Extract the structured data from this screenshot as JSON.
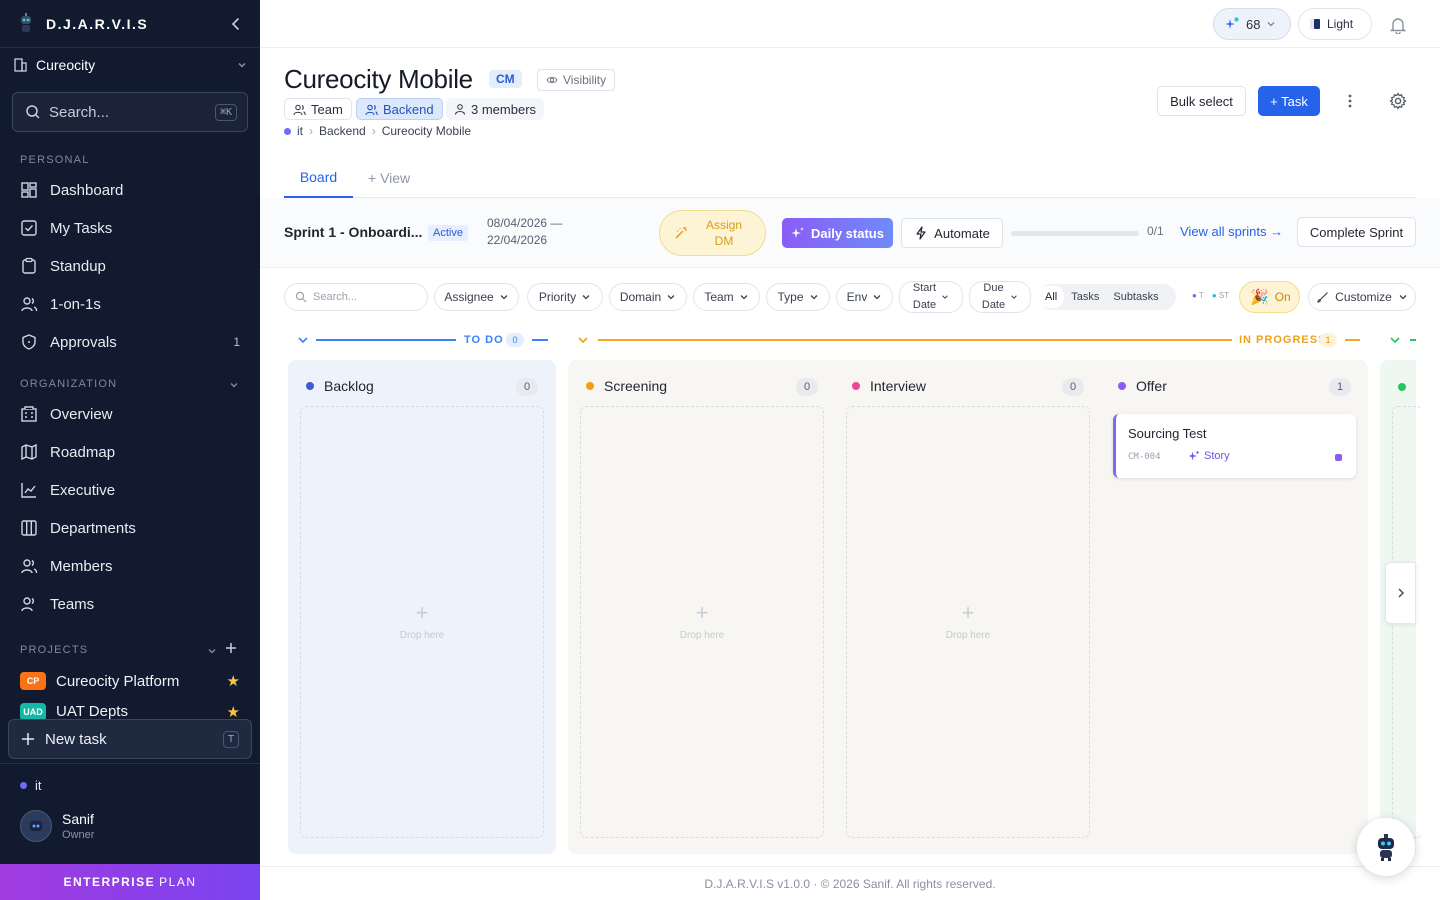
{
  "sidebar": {
    "brand": "D.J.A.R.V.I.S",
    "org": "Cureocity",
    "search_placeholder": "Search...",
    "search_kbd": "⌘K",
    "personal_label": "PERSONAL",
    "personal": [
      {
        "label": "Dashboard",
        "icon": "dashboard-icon"
      },
      {
        "label": "My Tasks",
        "icon": "checkbox-icon"
      },
      {
        "label": "Standup",
        "icon": "clipboard-icon"
      },
      {
        "label": "1-on-1s",
        "icon": "users-icon"
      },
      {
        "label": "Approvals",
        "icon": "shield-icon",
        "badge": "1"
      }
    ],
    "org_label": "ORGANIZATION",
    "organization": [
      {
        "label": "Overview",
        "icon": "building-icon"
      },
      {
        "label": "Roadmap",
        "icon": "map-icon"
      },
      {
        "label": "Executive",
        "icon": "chart-line-icon"
      },
      {
        "label": "Departments",
        "icon": "columns-icon"
      },
      {
        "label": "Members",
        "icon": "users-icon"
      },
      {
        "label": "Teams",
        "icon": "team-icon"
      }
    ],
    "projects_label": "PROJECTS",
    "projects": [
      {
        "tag": "CP",
        "name": "Cureocity Platform",
        "color": "#f97316"
      },
      {
        "tag": "UAD",
        "name": "UAT Depts",
        "color": "#14b8a6"
      }
    ],
    "new_task": "New task",
    "new_task_kbd": "T",
    "workspace": "it",
    "user": {
      "name": "Sanif",
      "role": "Owner"
    },
    "plan_bold": "ENTERPRISE",
    "plan_rest": "PLAN"
  },
  "topbar": {
    "points": "68",
    "theme": "Light"
  },
  "project": {
    "title": "Cureocity Mobile",
    "code": "CM",
    "visibility": "Visibility",
    "chips": {
      "team": "Team",
      "backend": "Backend",
      "members": "3 members"
    },
    "breadcrumb": [
      "it",
      "Backend",
      "Cureocity Mobile"
    ],
    "bulk_select": "Bulk select",
    "add_task": "+ Task"
  },
  "tabs": {
    "board": "Board",
    "view": "+ View"
  },
  "sprint": {
    "name": "Sprint 1 - Onboardi...",
    "status": "Active",
    "start": "08/04/2026 —",
    "end": "22/04/2026",
    "assign_dm_1": "Assign",
    "assign_dm_2": "DM",
    "daily_status": "Daily status",
    "automate": "Automate",
    "progress": 0,
    "progress_text": "0/1",
    "view_all": "View all sprints →",
    "complete": "Complete Sprint"
  },
  "filters": {
    "search_placeholder": "Search...",
    "assignee": "Assignee",
    "priority": "Priority",
    "domain": "Domain",
    "team": "Team",
    "type": "Type",
    "env": "Env",
    "start_date_1": "Start",
    "start_date_2": "Date",
    "due_date_1": "Due",
    "due_date_2": "Date",
    "seg": [
      "All",
      "Tasks",
      "Subtasks"
    ],
    "legend_t": "T",
    "legend_st": "ST",
    "toggle": "On",
    "customize": "Customize"
  },
  "groups": {
    "todo": {
      "label": "TO DO",
      "count": "0",
      "color": "#3b82f6"
    },
    "inprogress": {
      "label": "IN PROGRESS",
      "count": "1",
      "color": "#f59e0b"
    }
  },
  "columns": [
    {
      "name": "Backlog",
      "count": "0",
      "color": "#3b5bdb"
    },
    {
      "name": "Screening",
      "count": "0",
      "color": "#f59e0b"
    },
    {
      "name": "Interview",
      "count": "0",
      "color": "#ec4899"
    },
    {
      "name": "Offer",
      "count": "1",
      "color": "#8b5cf6"
    }
  ],
  "drop_here": "Drop here",
  "card": {
    "title": "Sourcing Test",
    "id": "CM-004",
    "type": "Story"
  },
  "footer": "D.J.A.R.V.I.S v1.0.0 · © 2026 Sanif. All rights reserved."
}
